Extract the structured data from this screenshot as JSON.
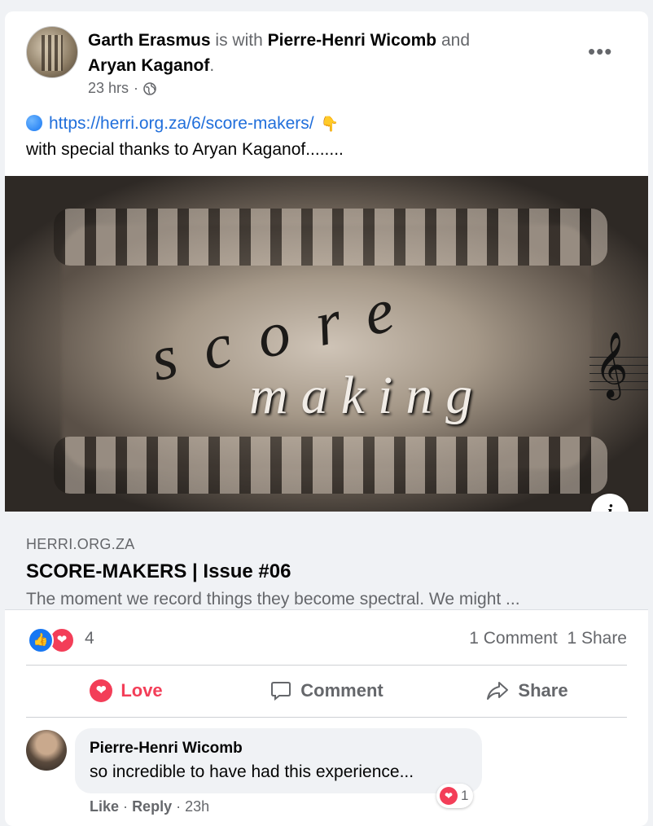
{
  "post": {
    "author": "Garth Erasmus",
    "with_text": "is with",
    "tagged1": "Pierre-Henri Wicomb",
    "and_text": "and",
    "tagged2": "Aryan Kaganof",
    "period": ".",
    "time": "23 hrs",
    "time_sep": "·",
    "more": "•••",
    "link": "https://herri.org.za/6/score-makers/",
    "text_line2": "with special thanks to Aryan Kaganof........"
  },
  "hero": {
    "word1": "score",
    "word2": "making",
    "info": "i"
  },
  "preview": {
    "domain": "HERRI.ORG.ZA",
    "title": "SCORE-MAKERS | Issue #06",
    "description": "The moment we record things they become spectral. We might ..."
  },
  "stats": {
    "reaction_count": "4",
    "comments": "1 Comment",
    "shares": "1 Share"
  },
  "actions": {
    "love": "Love",
    "comment": "Comment",
    "share": "Share"
  },
  "comment": {
    "name": "Pierre-Henri Wicomb",
    "text": "so incredible to have had this experience...",
    "reaction_count": "1",
    "like": "Like",
    "reply": "Reply",
    "time": "23h",
    "sep": "·"
  },
  "colors": {
    "link": "#216fdb",
    "love": "#f33e58",
    "like": "#1877f2",
    "muted": "#65676b"
  }
}
